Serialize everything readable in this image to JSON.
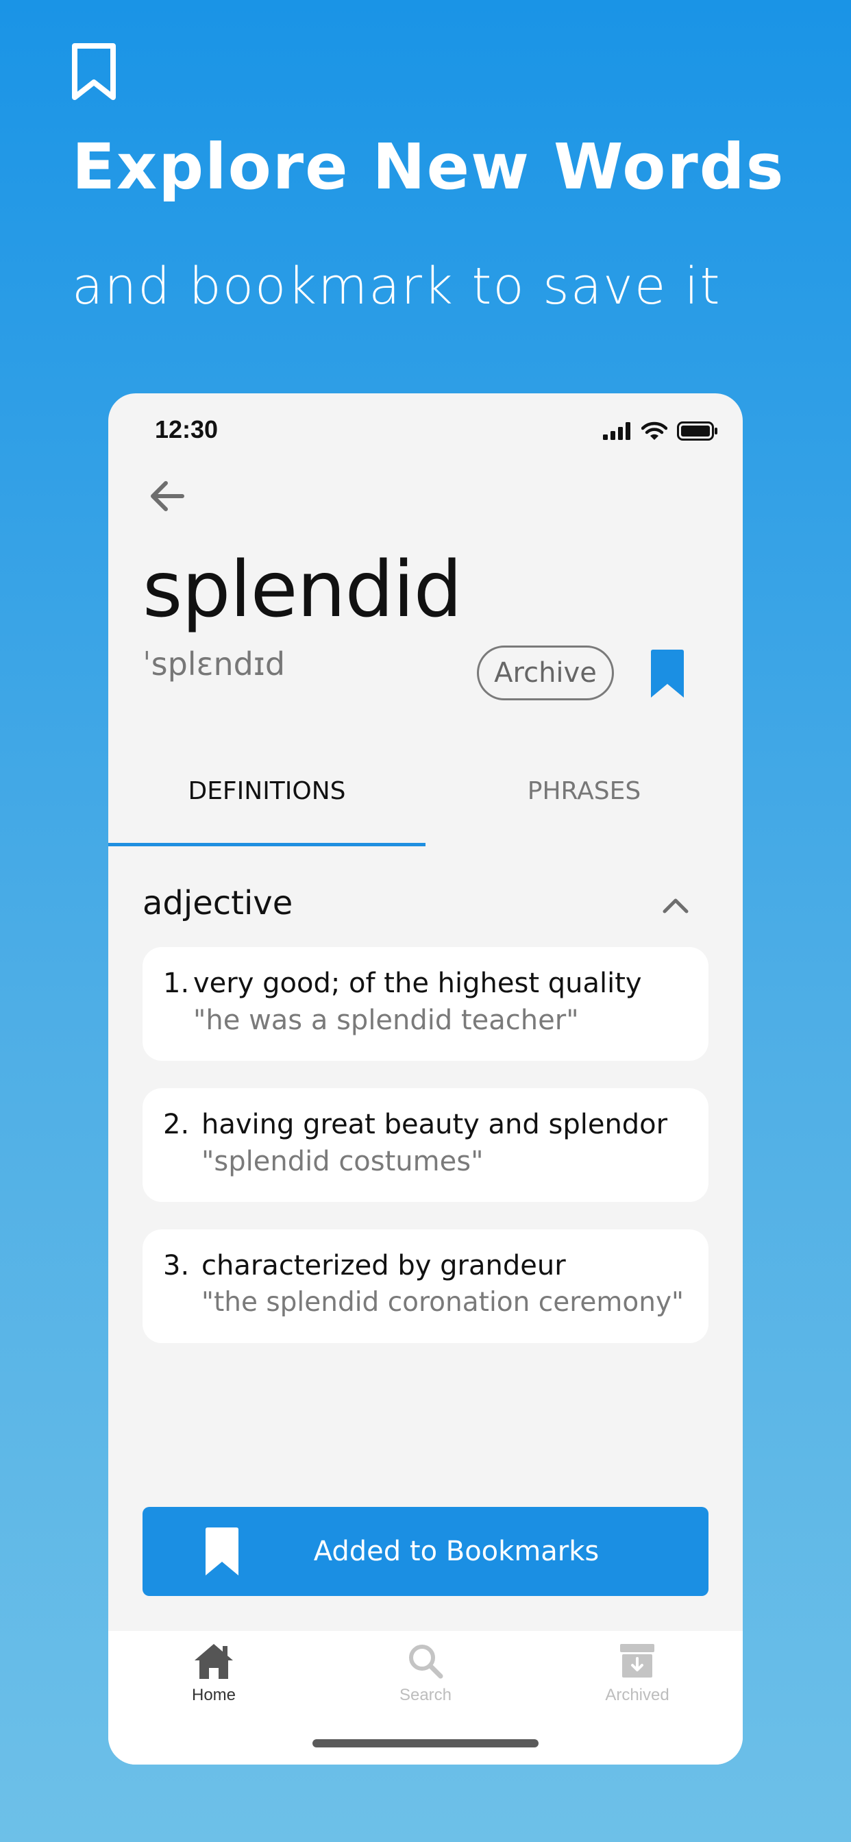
{
  "hero": {
    "title": "Explore New Words",
    "subtitle": "and bookmark to save it"
  },
  "status_bar": {
    "time": "12:30"
  },
  "word": {
    "term": "splendid",
    "phonetic": "ˈsplɛndɪd",
    "archive_label": "Archive",
    "bookmarked": true
  },
  "tabs": [
    {
      "label": "DEFINITIONS",
      "active": true
    },
    {
      "label": "PHRASES",
      "active": false
    }
  ],
  "part_of_speech": "adjective",
  "definitions": [
    {
      "num": "1.",
      "text": "very good; of the highest quality",
      "example": "\"he was a splendid teacher\""
    },
    {
      "num": "2.",
      "text": "having great beauty and splendor",
      "example": "\"splendid costumes\""
    },
    {
      "num": "3.",
      "text": "characterized by grandeur",
      "example": "\"the splendid coronation ceremony\""
    }
  ],
  "cta": {
    "label": "Added to Bookmarks"
  },
  "bottom_nav": [
    {
      "label": "Home",
      "icon": "home-icon",
      "active": true
    },
    {
      "label": "Search",
      "icon": "search-icon",
      "active": false
    },
    {
      "label": "Archived",
      "icon": "archive-box-icon",
      "active": false
    }
  ],
  "colors": {
    "accent": "#1b8fe3",
    "background_top": "#1a94e6",
    "background_bottom": "#6dc0e8"
  }
}
